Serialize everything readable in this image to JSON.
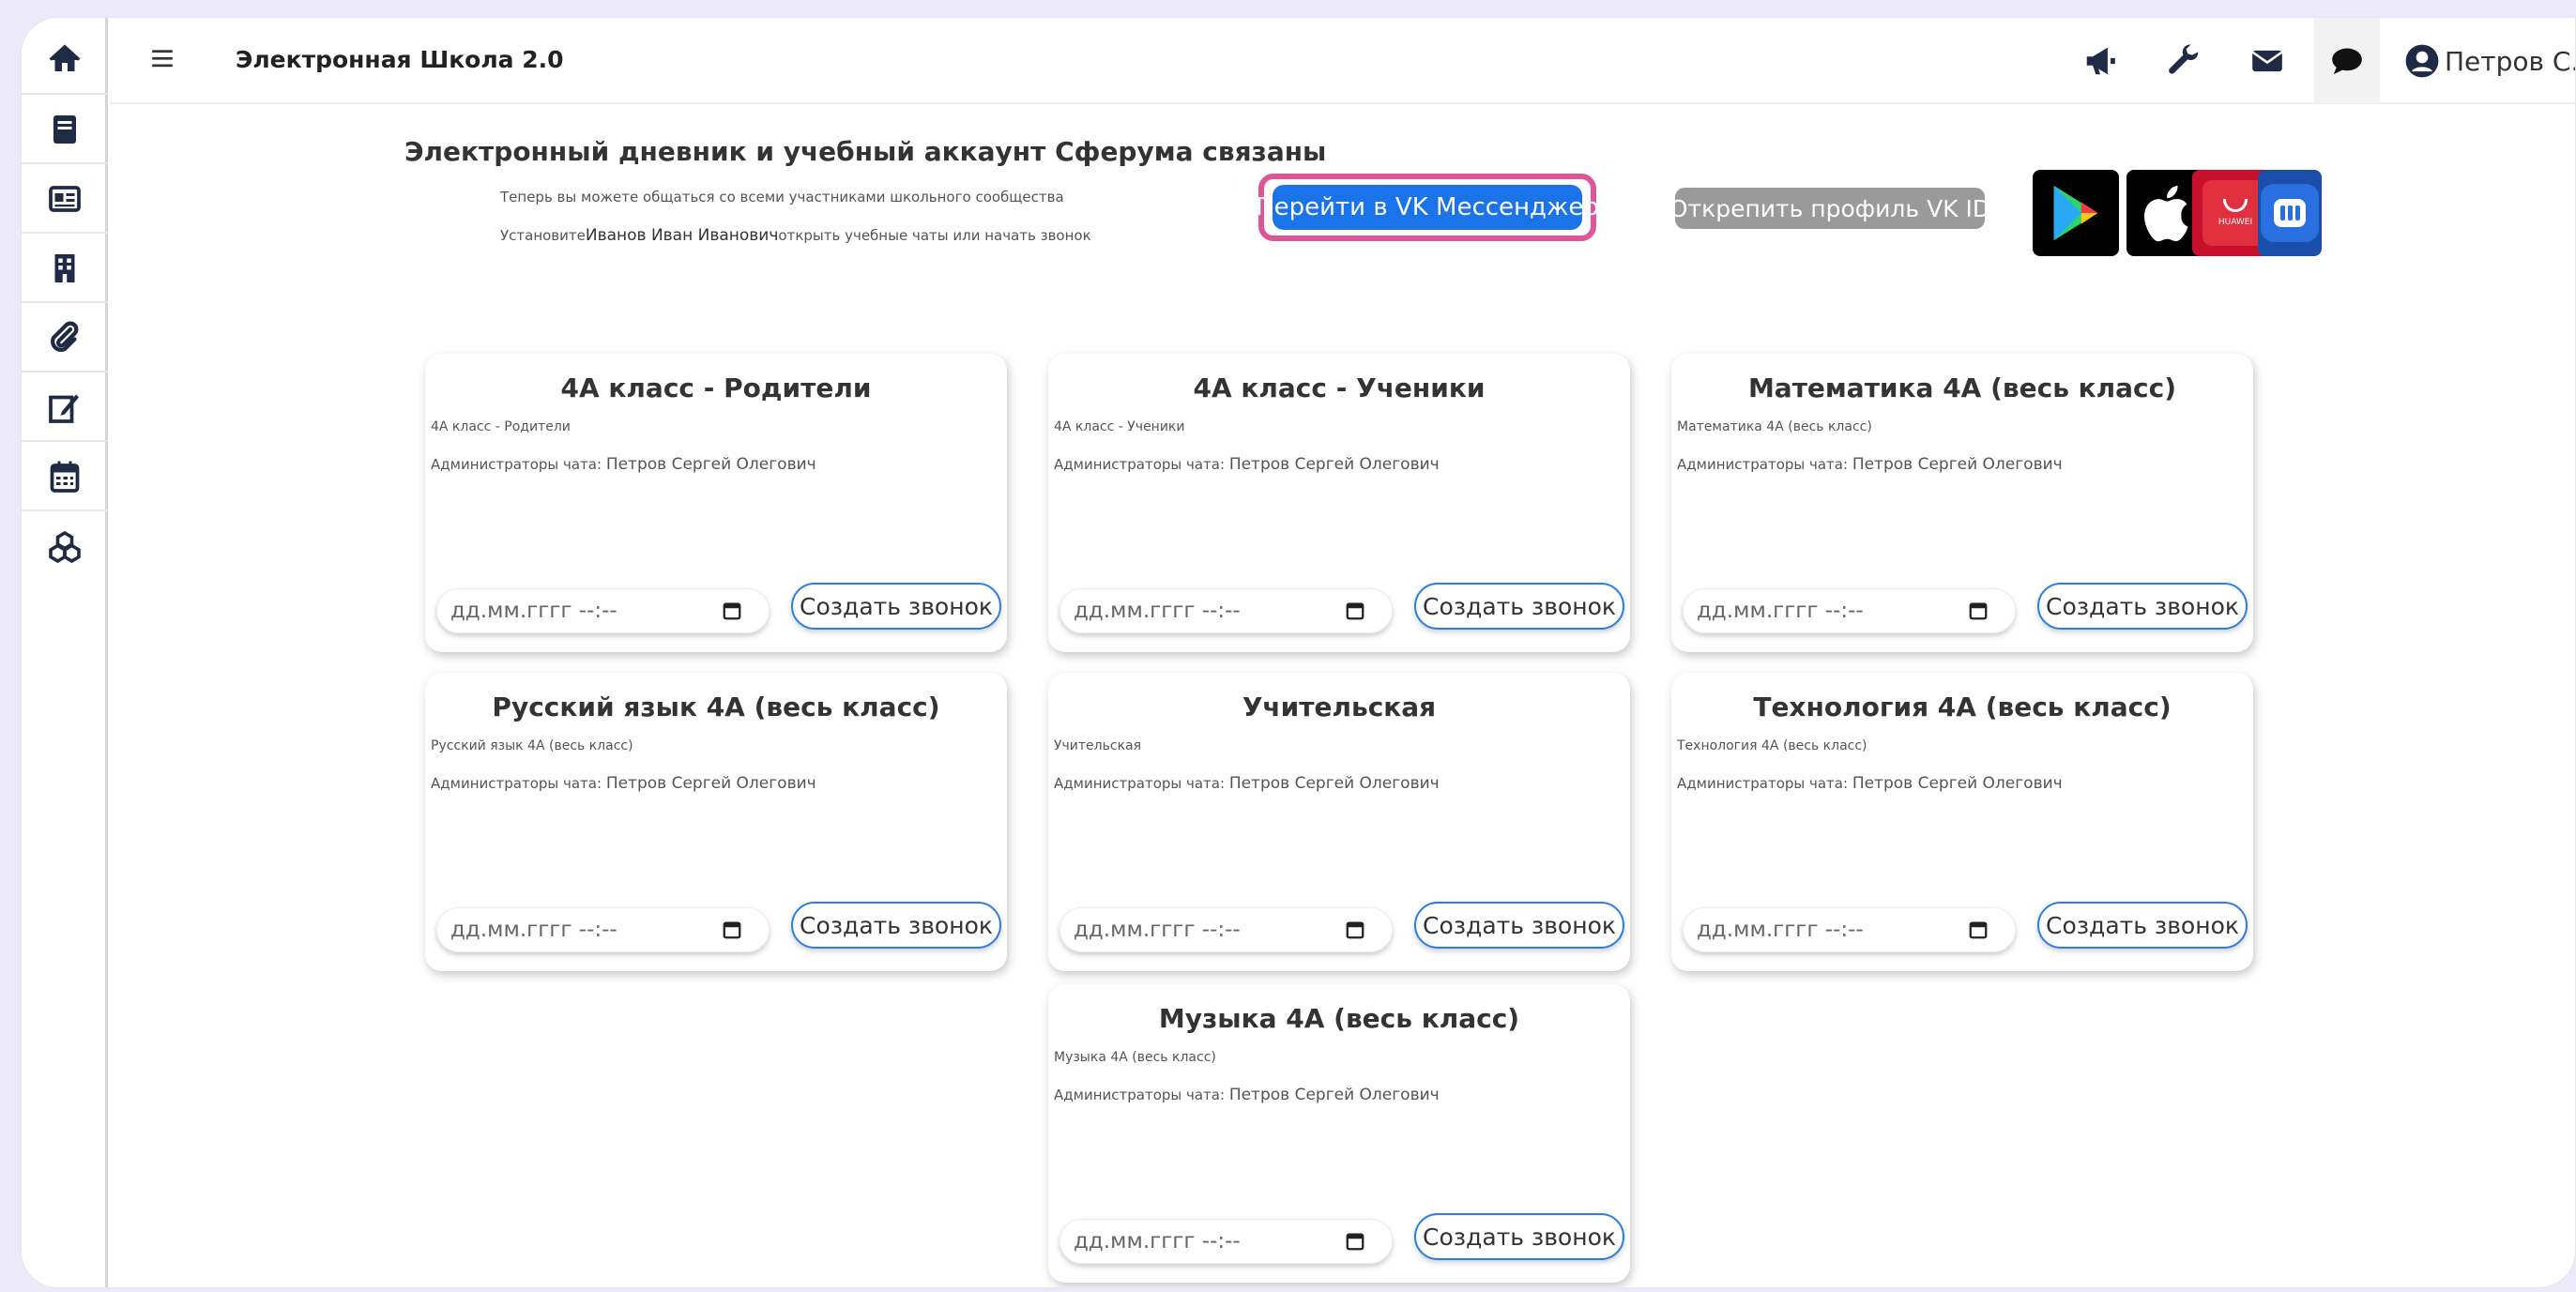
{
  "app": {
    "title": "Электронная Школа 2.0"
  },
  "user": {
    "name": "Петров С."
  },
  "header": {
    "title": "Электронный дневник и учебный аккаунт Сферума связаны",
    "subtitle_line1": "Теперь вы можете общаться со всеми участниками школьного сообщества",
    "subtitle_line2_prefix": "Установите",
    "subtitle_line2_name": "Иванов Иван Иванович",
    "subtitle_line2_suffix": "открыть учебные чаты или начать звонок",
    "vk_button": "Перейти в VK Мессенджер",
    "unlink_button": "Открепить профиль VK ID"
  },
  "store_icons": [
    "google-play-icon",
    "apple-icon",
    "huawei-appgallery-icon",
    "vk-messenger-icon"
  ],
  "card_common": {
    "admin_label": "Администраторы чата: ",
    "date_placeholder": "дд.мм.гггг --:--",
    "call_button": "Создать звонок"
  },
  "cards": [
    {
      "title": "4А класс - Родители",
      "name": "4А класс - Родители",
      "admin": "Петров Сергей Олегович"
    },
    {
      "title": "4А класс - Ученики",
      "name": "4А класс - Ученики",
      "admin": "Петров Сергей Олегович"
    },
    {
      "title": "Математика 4А (весь класс)",
      "name": "Математика 4А (весь класс)",
      "admin": "Петров Сергей Олегович"
    },
    {
      "title": "Русский язык 4А (весь класс)",
      "name": "Русский язык 4А (весь класс)",
      "admin": "Петров Сергей Олегович"
    },
    {
      "title": "Учительская",
      "name": "Учительская",
      "admin": "Петров Сергей Олегович"
    },
    {
      "title": "Технология 4А (весь класс)",
      "name": "Технология 4А (весь класс)",
      "admin": "Петров Сергей Олегович"
    },
    {
      "title": "Музыка 4А (весь класс)",
      "name": "Музыка 4А (весь класс)",
      "admin": "Петров Сергей Олегович"
    }
  ],
  "colors": {
    "accent": "#1a73e8",
    "highlight": "#e0559a",
    "sidebar_icon": "#1f2a44"
  }
}
